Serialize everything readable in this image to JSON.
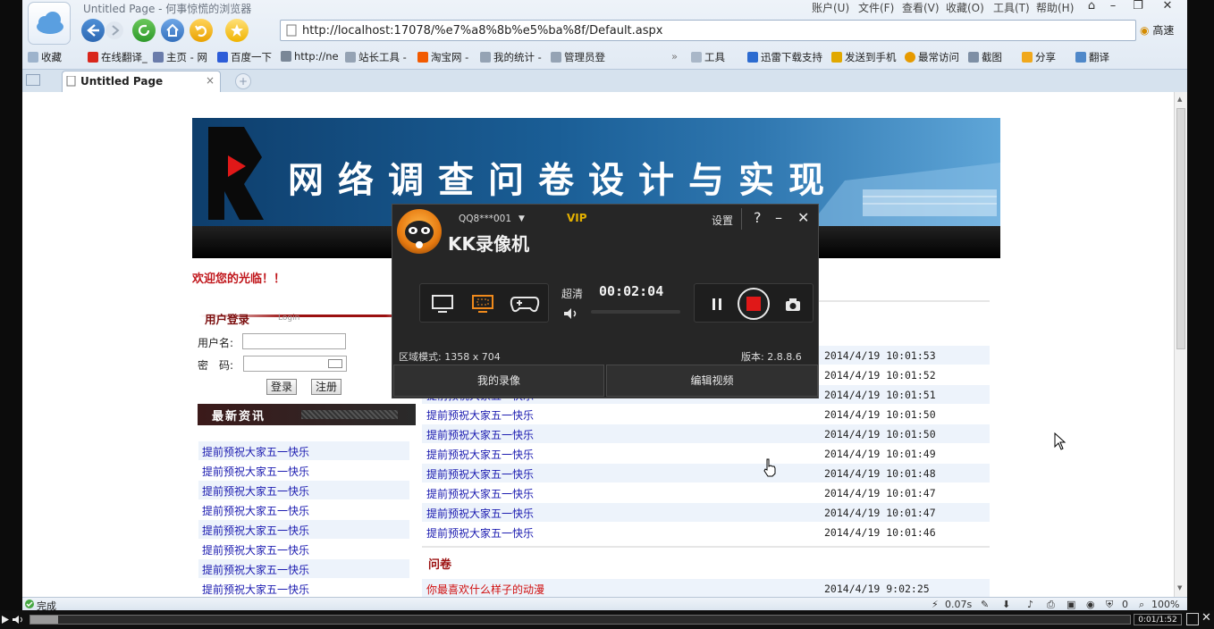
{
  "browser": {
    "window_title": "Untitled Page - 何事惊慌的浏览器",
    "menus": [
      "账户(U)",
      "文件(F)",
      "查看(V)",
      "收藏(O)",
      "工具(T)",
      "帮助(H)"
    ],
    "url": "http://localhost:17078/%e7%a8%8b%e5%ba%8f/Default.aspx",
    "speed_label": "高速",
    "bookmarks": [
      "收藏",
      "在线翻译_",
      "主页 - 网",
      "百度一下",
      "http://ne",
      "站长工具 -",
      "淘宝网 -",
      "我的统计 -",
      "管理员登"
    ],
    "bookmarks_right": [
      "工具",
      "迅雷下载支持",
      "发送到手机",
      "最常访问",
      "截图",
      "分享",
      "翻译"
    ],
    "tab_label": "Untitled Page",
    "status_text": "完成",
    "status_speed": "0.07s",
    "status_zoom": "100%",
    "status_zero": "0"
  },
  "page": {
    "banner_title": "网络调查问卷设计与实现",
    "welcome": "欢迎您的光临！！",
    "login": {
      "title": "用户登录",
      "subtitle": "Login",
      "username_label": "用户名:",
      "password_label": "密　码:",
      "login_button": "登录",
      "register_button": "注册"
    },
    "news_title": "最新资讯",
    "left_news": [
      "提前预祝大家五一快乐",
      "提前预祝大家五一快乐",
      "提前预祝大家五一快乐",
      "提前预祝大家五一快乐",
      "提前预祝大家五一快乐",
      "提前预祝大家五一快乐",
      "提前预祝大家五一快乐",
      "提前预祝大家五一快乐"
    ],
    "right_news": [
      {
        "title": "",
        "date": "2014/4/19 10:01:53"
      },
      {
        "title": "",
        "date": "2014/4/19 10:01:52"
      },
      {
        "title": "提前预祝大家五一快乐",
        "date": "2014/4/19 10:01:51"
      },
      {
        "title": "提前预祝大家五一快乐",
        "date": "2014/4/19 10:01:50"
      },
      {
        "title": "提前预祝大家五一快乐",
        "date": "2014/4/19 10:01:50"
      },
      {
        "title": "提前预祝大家五一快乐",
        "date": "2014/4/19 10:01:49"
      },
      {
        "title": "提前预祝大家五一快乐",
        "date": "2014/4/19 10:01:48"
      },
      {
        "title": "提前预祝大家五一快乐",
        "date": "2014/4/19 10:01:47"
      },
      {
        "title": "提前预祝大家五一快乐",
        "date": "2014/4/19 10:01:47"
      },
      {
        "title": "提前预祝大家五一快乐",
        "date": "2014/4/19 10:01:46"
      }
    ],
    "survey_title": "问卷",
    "survey_item": {
      "title": "你最喜欢什么样子的动漫",
      "date": "2014/4/19 9:02:25"
    }
  },
  "recorder": {
    "user": "QQ8***001",
    "vip": "VIP",
    "name": "KK录像机",
    "settings": "设置",
    "quality": "超清",
    "timer": "00:02:04",
    "area_mode": "区域模式: 1358 x 704",
    "version": "版本: 2.8.8.6",
    "my_videos": "我的录像",
    "edit_video": "编辑视频"
  },
  "player": {
    "time": "0:01/1:52",
    "progress": 0.025
  },
  "colors": {
    "banner": "#1a5e96",
    "welcome_red": "#c0161b",
    "link_blue": "#1b1bb0",
    "kk_bg": "#262626",
    "kk_vip": "#e5b100"
  }
}
